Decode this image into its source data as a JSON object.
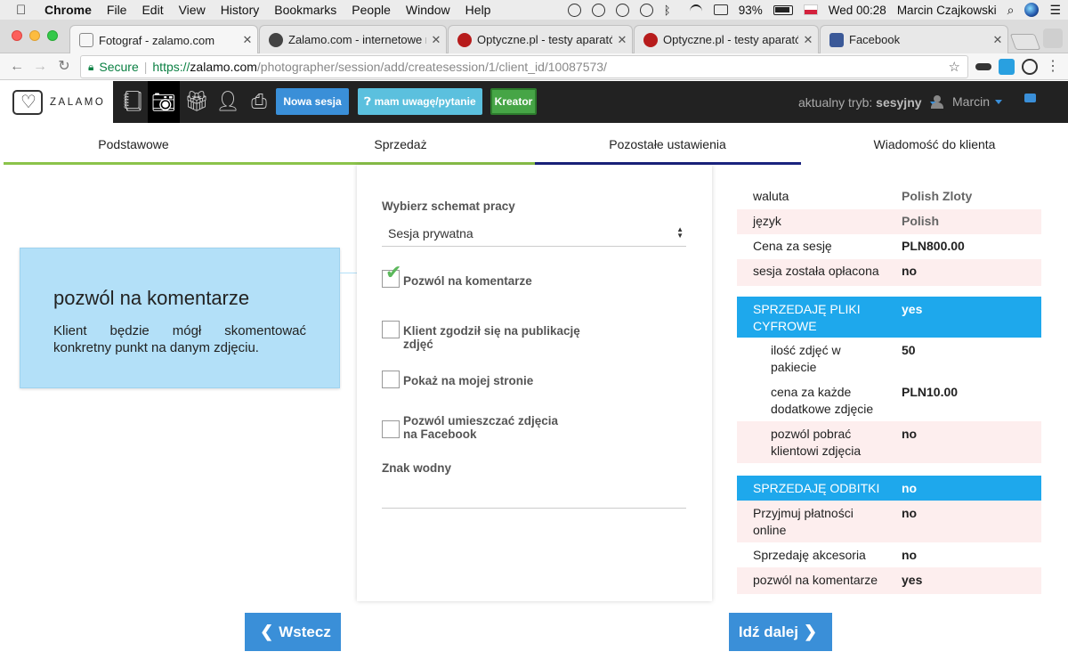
{
  "menubar": {
    "app": "Chrome",
    "items": [
      "File",
      "Edit",
      "View",
      "History",
      "Bookmarks",
      "People",
      "Window",
      "Help"
    ],
    "battery": "93%",
    "clock": "Wed 00:28",
    "user": "Marcin Czajkowski"
  },
  "tabs": [
    {
      "title": "Fotograf - zalamo.com",
      "favicon_color": "#888888"
    },
    {
      "title": "Zalamo.com - internetowe nar",
      "favicon_color": "#444444"
    },
    {
      "title": "Optyczne.pl - testy aparatów,",
      "favicon_color": "#b71c1c"
    },
    {
      "title": "Optyczne.pl - testy aparatów,",
      "favicon_color": "#b71c1c"
    },
    {
      "title": "Facebook",
      "favicon_color": "#3b5998"
    }
  ],
  "address": {
    "secure_label": "Secure",
    "scheme": "https://",
    "host": "zalamo.com",
    "path": "/photographer/session/add/createsession/1/client_id/10087573/"
  },
  "appbar": {
    "logo_text": "ZALAMO",
    "new_session": "Nowa sesja",
    "feedback": "mam uwagę/pytanie",
    "wizard": "Kreator",
    "mode_label": "aktualny tryb:",
    "mode_value": "sesyjny",
    "user": "Marcin"
  },
  "wizard_tabs": [
    "Podstawowe",
    "Sprzedaż",
    "Pozostałe ustawienia",
    "Wiadomość do klienta"
  ],
  "tooltip": {
    "title": "pozwól na komentarze",
    "text": "Klient będzie mógł skomentować konkretny punkt na danym zdjęciu."
  },
  "form": {
    "schema_label": "Wybierz schemat pracy",
    "schema_value": "Sesja prywatna",
    "checkboxes": [
      {
        "label": "Pozwól na komentarze",
        "checked": true
      },
      {
        "label": "Klient zgodził się na publikację zdjęć",
        "checked": false
      },
      {
        "label": "Pokaż na mojej stronie",
        "checked": false
      },
      {
        "label": "Pozwól umieszczać zdjęcia na Facebook",
        "checked": false
      }
    ],
    "watermark_label": "Znak wodny"
  },
  "summary": [
    {
      "key": "waluta",
      "value": "Polish Zloty"
    },
    {
      "key": "język",
      "value": "Polish"
    },
    {
      "key": "Cena za sesję",
      "value": "PLN800.00"
    },
    {
      "key": "sesja została opłacona",
      "value": "no"
    },
    {
      "key": "SPRZEDAJĘ PLIKI CYFROWE",
      "value": "yes"
    },
    {
      "key": "ilość zdjęć w pakiecie",
      "value": "50"
    },
    {
      "key": "cena za każde dodatkowe zdjęcie",
      "value": "PLN10.00"
    },
    {
      "key": "pozwól pobrać klientowi zdjęcia",
      "value": "no"
    },
    {
      "key": "SPRZEDAJĘ ODBITKI",
      "value": "no"
    },
    {
      "key": "Przyjmuj płatności online",
      "value": "no"
    },
    {
      "key": "Sprzedaję akcesoria",
      "value": "no"
    },
    {
      "key": "pozwól na komentarze",
      "value": "yes"
    }
  ],
  "nav": {
    "back": "Wstecz",
    "next": "Idź dalej"
  },
  "colors": {
    "accent_blue": "#3a8fd8",
    "summary_header": "#1ea8ec",
    "tooltip_bg": "#b3e0f8",
    "progress_green": "#8bc34a",
    "progress_navy": "#1a237e"
  }
}
